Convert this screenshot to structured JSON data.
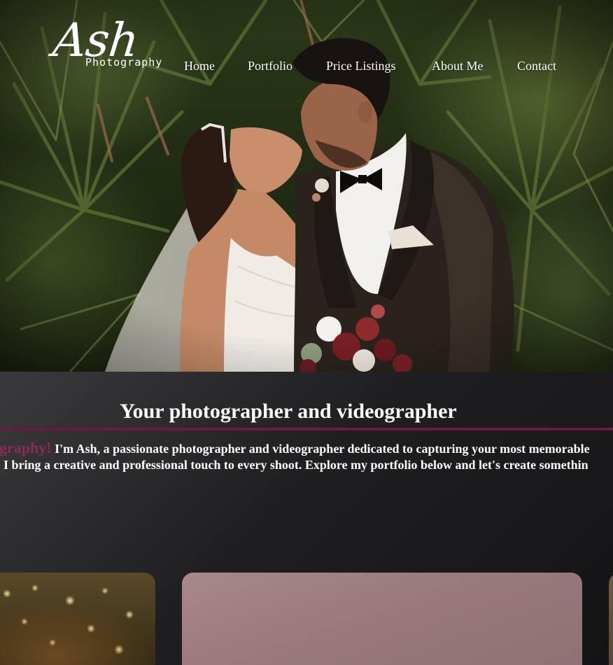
{
  "brand": {
    "logo_main": "Ash",
    "logo_sub": "Photography"
  },
  "nav": {
    "items": [
      {
        "label": "Home"
      },
      {
        "label": "Portfolio"
      },
      {
        "label": "Price Listings"
      },
      {
        "label": "About Me"
      },
      {
        "label": "Contact"
      }
    ]
  },
  "about": {
    "title": "Your photographer and videographer",
    "accent": "ography!",
    "line1": " I'm Ash, a passionate photographer and videographer dedicated to capturing your most memorable",
    "line2": ", I bring a creative and professional touch to every shoot. Explore my portfolio below and let's create somethin"
  },
  "colors": {
    "accent": "#6e1848",
    "accent_text": "#8a2a5e",
    "text": "#ffffff",
    "section_bg": "#1a1a1b"
  }
}
